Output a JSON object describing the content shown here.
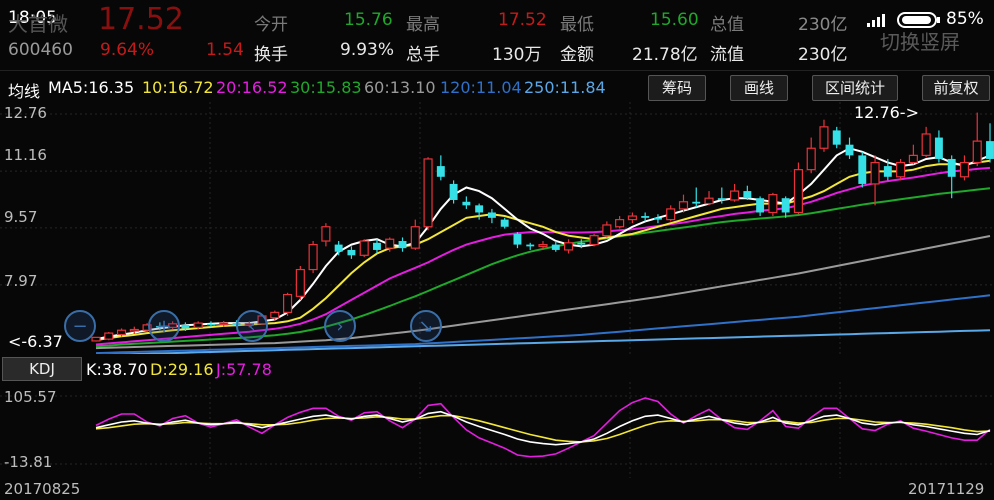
{
  "status": {
    "time": "18:05",
    "battery": "85%"
  },
  "header": {
    "stock_name": "大首微",
    "price": "17.52",
    "code": "600460",
    "change_pct": "9.64%",
    "change_amt": "1.54",
    "watermark": "切换竖屏",
    "fields": [
      {
        "label": "今开",
        "value": "15.76",
        "color": "green"
      },
      {
        "label": "最高",
        "value": "17.52",
        "color": "red"
      },
      {
        "label": "最低",
        "value": "15.60",
        "color": "green"
      },
      {
        "label": "总值",
        "value": "230亿",
        "color": "gray"
      },
      {
        "label": "换手",
        "value": "9.93%",
        "color": "white"
      },
      {
        "label": "总手",
        "value": "130万",
        "color": "white"
      },
      {
        "label": "金额",
        "value": "21.78亿",
        "color": "white"
      },
      {
        "label": "流值",
        "value": "230亿",
        "color": "white"
      }
    ]
  },
  "ma_bar": {
    "title": "均线",
    "items": [
      {
        "text": "MA5:16.35",
        "color": "#ffffff"
      },
      {
        "text": "10:16.72",
        "color": "#f2e63a"
      },
      {
        "text": "20:16.52",
        "color": "#e41ee0"
      },
      {
        "text": "30:15.83",
        "color": "#1fa82a"
      },
      {
        "text": "60:13.10",
        "color": "#9a9a9a"
      },
      {
        "text": "120:11.04",
        "color": "#2f70c8"
      },
      {
        "text": "250:11.84",
        "color": "#5aa8e8"
      }
    ],
    "buttons": [
      "筹码",
      "画线",
      "区间统计",
      "前复权"
    ]
  },
  "kdj": {
    "button": "KDJ",
    "k": "K:38.70",
    "d": "D:29.16",
    "j": "J:57.78",
    "k_color": "#ffffff",
    "d_color": "#f2e63a",
    "j_color": "#e41ee0"
  },
  "chart_data": {
    "type": "candlestick",
    "y_ticks": [
      "12.76",
      "11.16",
      "9.57",
      "7.97",
      "6.37"
    ],
    "ylim": [
      6.37,
      12.76
    ],
    "annotations": {
      "high": "12.76->",
      "low": "<-6.37"
    },
    "kdj_ticks": [
      "105.57",
      "-13.81"
    ],
    "kdj_ylim": [
      -13.81,
      105.57
    ],
    "x_labels": [
      "20170825",
      "20171129"
    ],
    "candles": [
      [
        6.4,
        6.5,
        6.45,
        6.38
      ],
      [
        6.45,
        6.62,
        6.65,
        6.42
      ],
      [
        6.58,
        6.7,
        6.75,
        6.52
      ],
      [
        6.68,
        6.72,
        6.8,
        6.6
      ],
      [
        6.7,
        6.85,
        6.9,
        6.65
      ],
      [
        6.82,
        6.78,
        6.92,
        6.7
      ],
      [
        6.78,
        6.88,
        6.95,
        6.72
      ],
      [
        6.85,
        6.75,
        6.92,
        6.68
      ],
      [
        6.78,
        6.9,
        6.95,
        6.72
      ],
      [
        6.88,
        6.86,
        6.95,
        6.78
      ],
      [
        6.86,
        6.9,
        6.96,
        6.8
      ],
      [
        6.9,
        6.84,
        6.98,
        6.78
      ],
      [
        6.84,
        6.88,
        6.95,
        6.78
      ],
      [
        6.88,
        7.1,
        7.12,
        6.85
      ],
      [
        7.05,
        7.2,
        7.25,
        6.98
      ],
      [
        7.2,
        7.7,
        7.75,
        7.1
      ],
      [
        7.65,
        8.4,
        8.5,
        7.55
      ],
      [
        8.4,
        9.1,
        9.2,
        8.3
      ],
      [
        9.2,
        9.6,
        9.7,
        9.05
      ],
      [
        9.1,
        8.9,
        9.2,
        8.8
      ],
      [
        8.95,
        8.8,
        9.05,
        8.7
      ],
      [
        8.8,
        9.2,
        9.25,
        8.75
      ],
      [
        9.15,
        8.95,
        9.25,
        8.85
      ],
      [
        9.0,
        9.25,
        9.3,
        8.9
      ],
      [
        9.2,
        9.0,
        9.3,
        8.9
      ],
      [
        9.0,
        9.6,
        9.8,
        8.95
      ],
      [
        9.6,
        11.5,
        11.55,
        9.5
      ],
      [
        11.3,
        11.0,
        11.6,
        10.9
      ],
      [
        10.8,
        10.35,
        10.9,
        10.25
      ],
      [
        10.3,
        10.2,
        10.45,
        10.1
      ],
      [
        10.2,
        10.0,
        10.25,
        9.8
      ],
      [
        10.0,
        9.85,
        10.1,
        9.7
      ],
      [
        9.8,
        9.6,
        9.85,
        9.55
      ],
      [
        9.4,
        9.1,
        9.45,
        9.0
      ],
      [
        9.1,
        9.05,
        9.15,
        8.95
      ],
      [
        9.05,
        9.1,
        9.2,
        8.95
      ],
      [
        9.1,
        8.95,
        9.2,
        8.9
      ],
      [
        8.95,
        9.15,
        9.25,
        8.85
      ],
      [
        9.15,
        9.1,
        9.25,
        9.0
      ],
      [
        9.1,
        9.35,
        9.4,
        9.05
      ],
      [
        9.35,
        9.65,
        9.75,
        9.3
      ],
      [
        9.6,
        9.8,
        9.9,
        9.55
      ],
      [
        9.8,
        9.9,
        10.0,
        9.7
      ],
      [
        9.9,
        9.85,
        10.0,
        9.75
      ],
      [
        9.85,
        9.8,
        9.95,
        9.7
      ],
      [
        9.8,
        10.1,
        10.2,
        9.75
      ],
      [
        10.1,
        10.3,
        10.5,
        10.0
      ],
      [
        10.3,
        10.25,
        10.7,
        10.15
      ],
      [
        10.25,
        10.4,
        10.6,
        10.2
      ],
      [
        10.4,
        10.35,
        10.7,
        10.25
      ],
      [
        10.35,
        10.6,
        10.8,
        10.3
      ],
      [
        10.6,
        10.4,
        10.75,
        10.35
      ],
      [
        10.4,
        10.0,
        10.45,
        9.9
      ],
      [
        10.0,
        10.5,
        10.55,
        9.9
      ],
      [
        10.4,
        10.0,
        10.45,
        9.85
      ],
      [
        10.0,
        11.2,
        11.4,
        9.95
      ],
      [
        11.2,
        11.8,
        12.1,
        11.1
      ],
      [
        11.8,
        12.4,
        12.6,
        11.7
      ],
      [
        12.3,
        11.9,
        12.4,
        11.8
      ],
      [
        11.9,
        11.6,
        12.1,
        11.5
      ],
      [
        11.6,
        10.8,
        11.7,
        10.7
      ],
      [
        10.8,
        11.4,
        11.6,
        10.2
      ],
      [
        11.3,
        11.0,
        11.5,
        10.9
      ],
      [
        11.0,
        11.4,
        11.5,
        10.9
      ],
      [
        11.4,
        11.6,
        11.9,
        11.35
      ],
      [
        11.6,
        12.2,
        12.4,
        11.55
      ],
      [
        12.1,
        11.5,
        12.3,
        11.4
      ],
      [
        11.5,
        11.0,
        11.6,
        10.4
      ],
      [
        11.0,
        11.4,
        11.6,
        10.9
      ],
      [
        11.4,
        12.0,
        12.8,
        11.3
      ],
      [
        12.0,
        11.5,
        12.5,
        11.4
      ]
    ],
    "ma5": [
      6.45,
      6.52,
      6.58,
      6.63,
      6.7,
      6.75,
      6.8,
      6.84,
      6.86,
      6.88,
      6.9,
      6.9,
      6.9,
      6.95,
      7.0,
      7.2,
      7.55,
      8.0,
      8.5,
      8.9,
      9.1,
      9.2,
      9.25,
      9.1,
      9.05,
      9.15,
      9.6,
      10.1,
      10.5,
      10.7,
      10.6,
      10.4,
      10.1,
      9.8,
      9.55,
      9.4,
      9.2,
      9.1,
      9.05,
      9.1,
      9.2,
      9.4,
      9.6,
      9.75,
      9.85,
      9.95,
      10.05,
      10.15,
      10.25,
      10.35,
      10.4,
      10.4,
      10.35,
      10.3,
      10.25,
      10.5,
      10.8,
      11.2,
      11.6,
      11.8,
      11.7,
      11.55,
      11.4,
      11.3,
      11.35,
      11.5,
      11.55,
      11.4,
      11.3,
      11.45,
      11.6
    ],
    "ma10": [
      6.42,
      6.48,
      6.53,
      6.57,
      6.62,
      6.66,
      6.7,
      6.73,
      6.76,
      6.79,
      6.82,
      6.84,
      6.86,
      6.88,
      6.9,
      6.95,
      7.05,
      7.3,
      7.6,
      7.95,
      8.3,
      8.6,
      8.85,
      9.0,
      9.05,
      9.1,
      9.25,
      9.45,
      9.65,
      9.85,
      9.9,
      9.95,
      9.9,
      9.8,
      9.7,
      9.6,
      9.45,
      9.35,
      9.3,
      9.25,
      9.3,
      9.35,
      9.4,
      9.5,
      9.6,
      9.7,
      9.8,
      9.9,
      10.0,
      10.1,
      10.15,
      10.2,
      10.25,
      10.25,
      10.25,
      10.35,
      10.45,
      10.6,
      10.8,
      11.0,
      11.1,
      11.15,
      11.15,
      11.15,
      11.2,
      11.3,
      11.35,
      11.35,
      11.35,
      11.4,
      11.45
    ],
    "ma20": [
      6.3,
      6.33,
      6.36,
      6.39,
      6.42,
      6.45,
      6.48,
      6.51,
      6.54,
      6.57,
      6.6,
      6.63,
      6.66,
      6.7,
      6.74,
      6.8,
      6.88,
      7.0,
      7.15,
      7.35,
      7.55,
      7.75,
      7.95,
      8.15,
      8.3,
      8.45,
      8.6,
      8.78,
      8.95,
      9.1,
      9.2,
      9.3,
      9.38,
      9.42,
      9.45,
      9.45,
      9.45,
      9.44,
      9.44,
      9.45,
      9.47,
      9.5,
      9.53,
      9.57,
      9.62,
      9.67,
      9.72,
      9.78,
      9.85,
      9.9,
      9.96,
      10.0,
      10.05,
      10.08,
      10.12,
      10.2,
      10.3,
      10.42,
      10.55,
      10.65,
      10.75,
      10.82,
      10.88,
      10.93,
      10.98,
      11.04,
      11.1,
      11.15,
      11.18,
      11.22,
      11.25
    ],
    "ma30": [
      6.25,
      6.27,
      6.3,
      6.32,
      6.34,
      6.36,
      6.38,
      6.4,
      6.42,
      6.44,
      6.46,
      6.48,
      6.5,
      6.53,
      6.56,
      6.6,
      6.65,
      6.72,
      6.8,
      6.9,
      7.0,
      7.12,
      7.25,
      7.38,
      7.52,
      7.65,
      7.8,
      7.95,
      8.1,
      8.25,
      8.4,
      8.55,
      8.68,
      8.8,
      8.9,
      8.98,
      9.05,
      9.12,
      9.18,
      9.23,
      9.28,
      9.33,
      9.38,
      9.43,
      9.48,
      9.53,
      9.58,
      9.63,
      9.68,
      9.73,
      9.77,
      9.8,
      9.83,
      9.86,
      9.89,
      9.93,
      9.98,
      10.04,
      10.1,
      10.16,
      10.22,
      10.27,
      10.32,
      10.37,
      10.42,
      10.47,
      10.52,
      10.56,
      10.6,
      10.64,
      10.68
    ],
    "ma60": [
      6.2,
      6.21,
      6.22,
      6.23,
      6.24,
      6.25,
      6.26,
      6.27,
      6.28,
      6.29,
      6.3,
      6.31,
      6.32,
      6.33,
      6.34,
      6.36,
      6.38,
      6.4,
      6.42,
      6.45,
      6.48,
      6.52,
      6.56,
      6.6,
      6.64,
      6.68,
      6.73,
      6.78,
      6.83,
      6.88,
      6.93,
      6.98,
      7.03,
      7.08,
      7.13,
      7.18,
      7.23,
      7.28,
      7.33,
      7.38,
      7.43,
      7.48,
      7.53,
      7.58,
      7.63,
      7.69,
      7.75,
      7.81,
      7.87,
      7.93,
      7.99,
      8.05,
      8.11,
      8.17,
      8.23,
      8.29,
      8.36,
      8.43,
      8.5,
      8.57,
      8.64,
      8.71,
      8.78,
      8.85,
      8.92,
      8.99,
      9.06,
      9.13,
      9.2,
      9.27,
      9.34
    ],
    "ma120": [
      6.06,
      6.07,
      6.08,
      6.09,
      6.1,
      6.11,
      6.12,
      6.13,
      6.14,
      6.15,
      6.16,
      6.17,
      6.18,
      6.19,
      6.2,
      6.21,
      6.22,
      6.23,
      6.24,
      6.25,
      6.26,
      6.27,
      6.28,
      6.29,
      6.3,
      6.31,
      6.33,
      6.35,
      6.37,
      6.39,
      6.41,
      6.43,
      6.45,
      6.47,
      6.49,
      6.51,
      6.53,
      6.55,
      6.57,
      6.6,
      6.63,
      6.66,
      6.69,
      6.72,
      6.75,
      6.78,
      6.81,
      6.84,
      6.87,
      6.9,
      6.93,
      6.96,
      6.99,
      7.02,
      7.05,
      7.08,
      7.12,
      7.16,
      7.2,
      7.24,
      7.28,
      7.32,
      7.36,
      7.4,
      7.44,
      7.48,
      7.52,
      7.56,
      7.6,
      7.64,
      7.68
    ],
    "ma250": [
      6.0,
      6.01,
      6.02,
      6.03,
      6.04,
      6.05,
      6.06,
      6.07,
      6.08,
      6.09,
      6.1,
      6.11,
      6.12,
      6.13,
      6.14,
      6.15,
      6.16,
      6.17,
      6.18,
      6.19,
      6.2,
      6.21,
      6.22,
      6.23,
      6.24,
      6.25,
      6.26,
      6.27,
      6.28,
      6.29,
      6.3,
      6.31,
      6.32,
      6.33,
      6.34,
      6.35,
      6.36,
      6.37,
      6.38,
      6.39,
      6.4,
      6.41,
      6.42,
      6.43,
      6.44,
      6.45,
      6.46,
      6.47,
      6.48,
      6.49,
      6.5,
      6.51,
      6.52,
      6.53,
      6.54,
      6.55,
      6.56,
      6.57,
      6.58,
      6.59,
      6.6,
      6.61,
      6.62,
      6.63,
      6.64,
      6.65,
      6.66,
      6.67,
      6.68,
      6.69,
      6.7
    ],
    "kdj_k": [
      50,
      55,
      60,
      62,
      58,
      55,
      60,
      63,
      58,
      55,
      57,
      60,
      55,
      50,
      55,
      60,
      65,
      70,
      72,
      68,
      65,
      70,
      72,
      66,
      60,
      65,
      75,
      78,
      70,
      60,
      52,
      45,
      38,
      30,
      25,
      22,
      20,
      22,
      25,
      30,
      40,
      52,
      62,
      70,
      72,
      66,
      60,
      65,
      70,
      64,
      58,
      55,
      60,
      68,
      58,
      55,
      62,
      70,
      72,
      66,
      58,
      55,
      58,
      60,
      55,
      52,
      48,
      44,
      40,
      38,
      45
    ],
    "kdj_d": [
      48,
      50,
      53,
      56,
      57,
      56,
      57,
      59,
      58,
      57,
      57,
      58,
      57,
      55,
      55,
      56,
      59,
      63,
      66,
      67,
      66,
      67,
      69,
      68,
      65,
      65,
      68,
      71,
      71,
      67,
      62,
      56,
      50,
      44,
      38,
      33,
      28,
      26,
      25,
      27,
      31,
      38,
      46,
      54,
      60,
      62,
      61,
      62,
      64,
      64,
      62,
      59,
      59,
      62,
      61,
      58,
      59,
      63,
      66,
      66,
      63,
      60,
      59,
      59,
      58,
      56,
      53,
      50,
      46,
      43,
      44
    ],
    "kdj_j": [
      54,
      65,
      74,
      74,
      60,
      53,
      66,
      71,
      58,
      51,
      57,
      64,
      51,
      40,
      55,
      68,
      77,
      84,
      84,
      70,
      63,
      76,
      78,
      62,
      50,
      65,
      89,
      92,
      68,
      46,
      32,
      23,
      14,
      2,
      -1,
      0,
      4,
      14,
      25,
      36,
      58,
      80,
      94,
      102,
      96,
      74,
      58,
      71,
      82,
      64,
      50,
      47,
      62,
      80,
      52,
      49,
      68,
      84,
      84,
      66,
      48,
      45,
      56,
      62,
      49,
      44,
      38,
      32,
      28,
      28,
      47
    ]
  }
}
